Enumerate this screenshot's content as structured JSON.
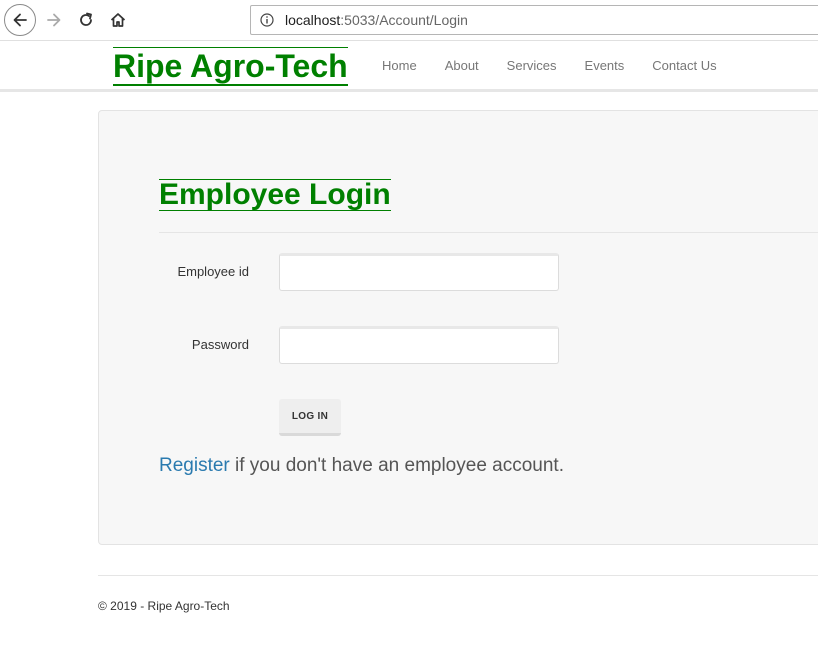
{
  "browser": {
    "url_host": "localhost",
    "url_rest": ":5033/Account/Login"
  },
  "header": {
    "brand": "Ripe Agro-Tech",
    "nav": [
      "Home",
      "About",
      "Services",
      "Events",
      "Contact Us"
    ]
  },
  "login": {
    "title": "Employee Login",
    "employee_id_label": "Employee id",
    "employee_id_value": "",
    "password_label": "Password",
    "password_value": "",
    "button_label": "LOG IN",
    "register_link": "Register",
    "register_text": " if you don't have an employee account."
  },
  "footer": {
    "text": "© 2019 - Ripe Agro-Tech"
  },
  "colors": {
    "brand_green": "#008000",
    "link_blue": "#2a7aaf",
    "panel_bg": "#f7f7f7"
  },
  "icons": [
    "back-icon",
    "forward-icon",
    "reload-icon",
    "home-icon",
    "info-icon"
  ]
}
